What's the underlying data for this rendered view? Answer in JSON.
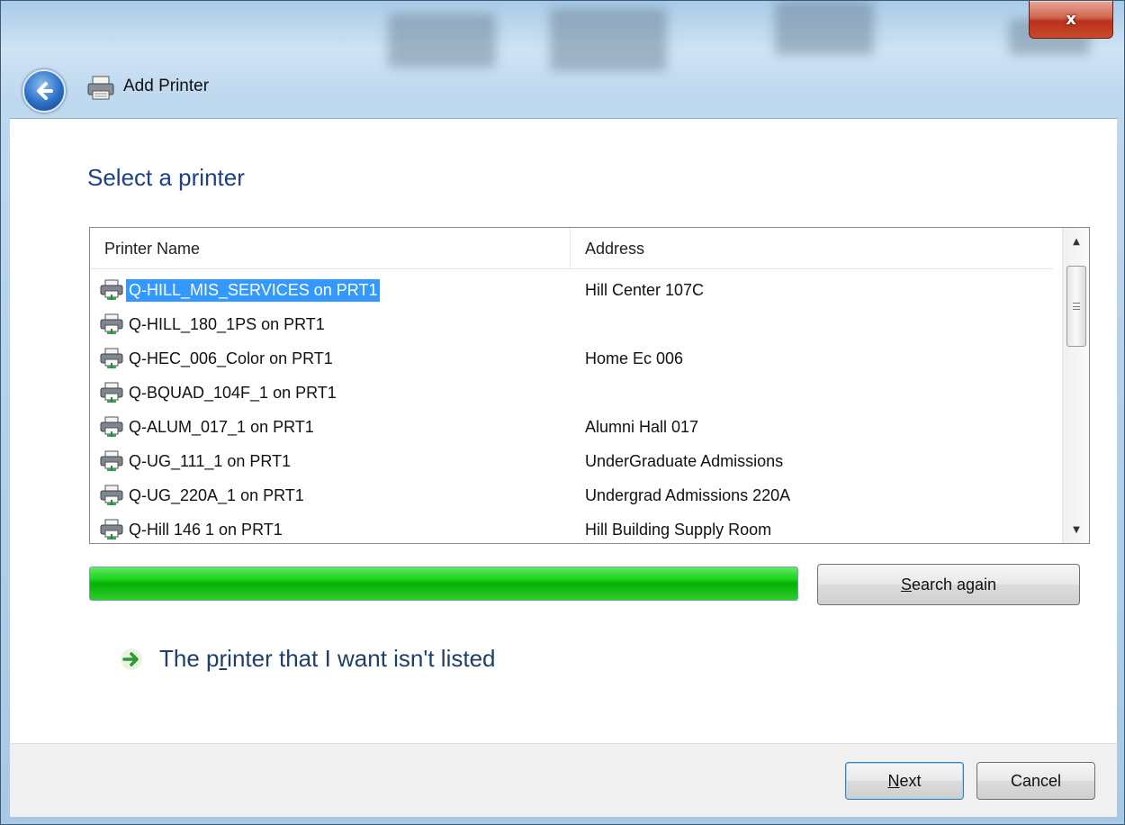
{
  "window": {
    "title": "Add Printer",
    "close_label": "x"
  },
  "page": {
    "heading": "Select a printer"
  },
  "printer_list": {
    "columns": [
      "Printer Name",
      "Address"
    ],
    "rows": [
      {
        "name": "Q-HILL_MIS_SERVICES on PRT1",
        "address": "Hill Center 107C",
        "selected": true
      },
      {
        "name": "Q-HILL_180_1PS on PRT1",
        "address": ""
      },
      {
        "name": "Q-HEC_006_Color on PRT1",
        "address": "Home Ec 006"
      },
      {
        "name": "Q-BQUAD_104F_1 on PRT1",
        "address": ""
      },
      {
        "name": "Q-ALUM_017_1 on PRT1",
        "address": "Alumni Hall 017"
      },
      {
        "name": "Q-UG_111_1 on PRT1",
        "address": "UnderGraduate Admissions"
      },
      {
        "name": "Q-UG_220A_1 on PRT1",
        "address": "Undergrad Admissions 220A"
      },
      {
        "name": "Q-Hill 146 1 on PRT1",
        "address": "Hill Building Supply Room"
      }
    ]
  },
  "search": {
    "progress_percent": 100,
    "search_again": {
      "prefix": "",
      "accel": "S",
      "rest": "earch again"
    }
  },
  "link": {
    "pre": "The p",
    "accel": "r",
    "post": "inter that I want isn't listed"
  },
  "footer": {
    "next": {
      "accel": "N",
      "rest": "ext"
    },
    "cancel": "Cancel"
  },
  "colors": {
    "heading": "#1e3f8a",
    "selection": "#3399ff",
    "progress": "#06b006"
  }
}
